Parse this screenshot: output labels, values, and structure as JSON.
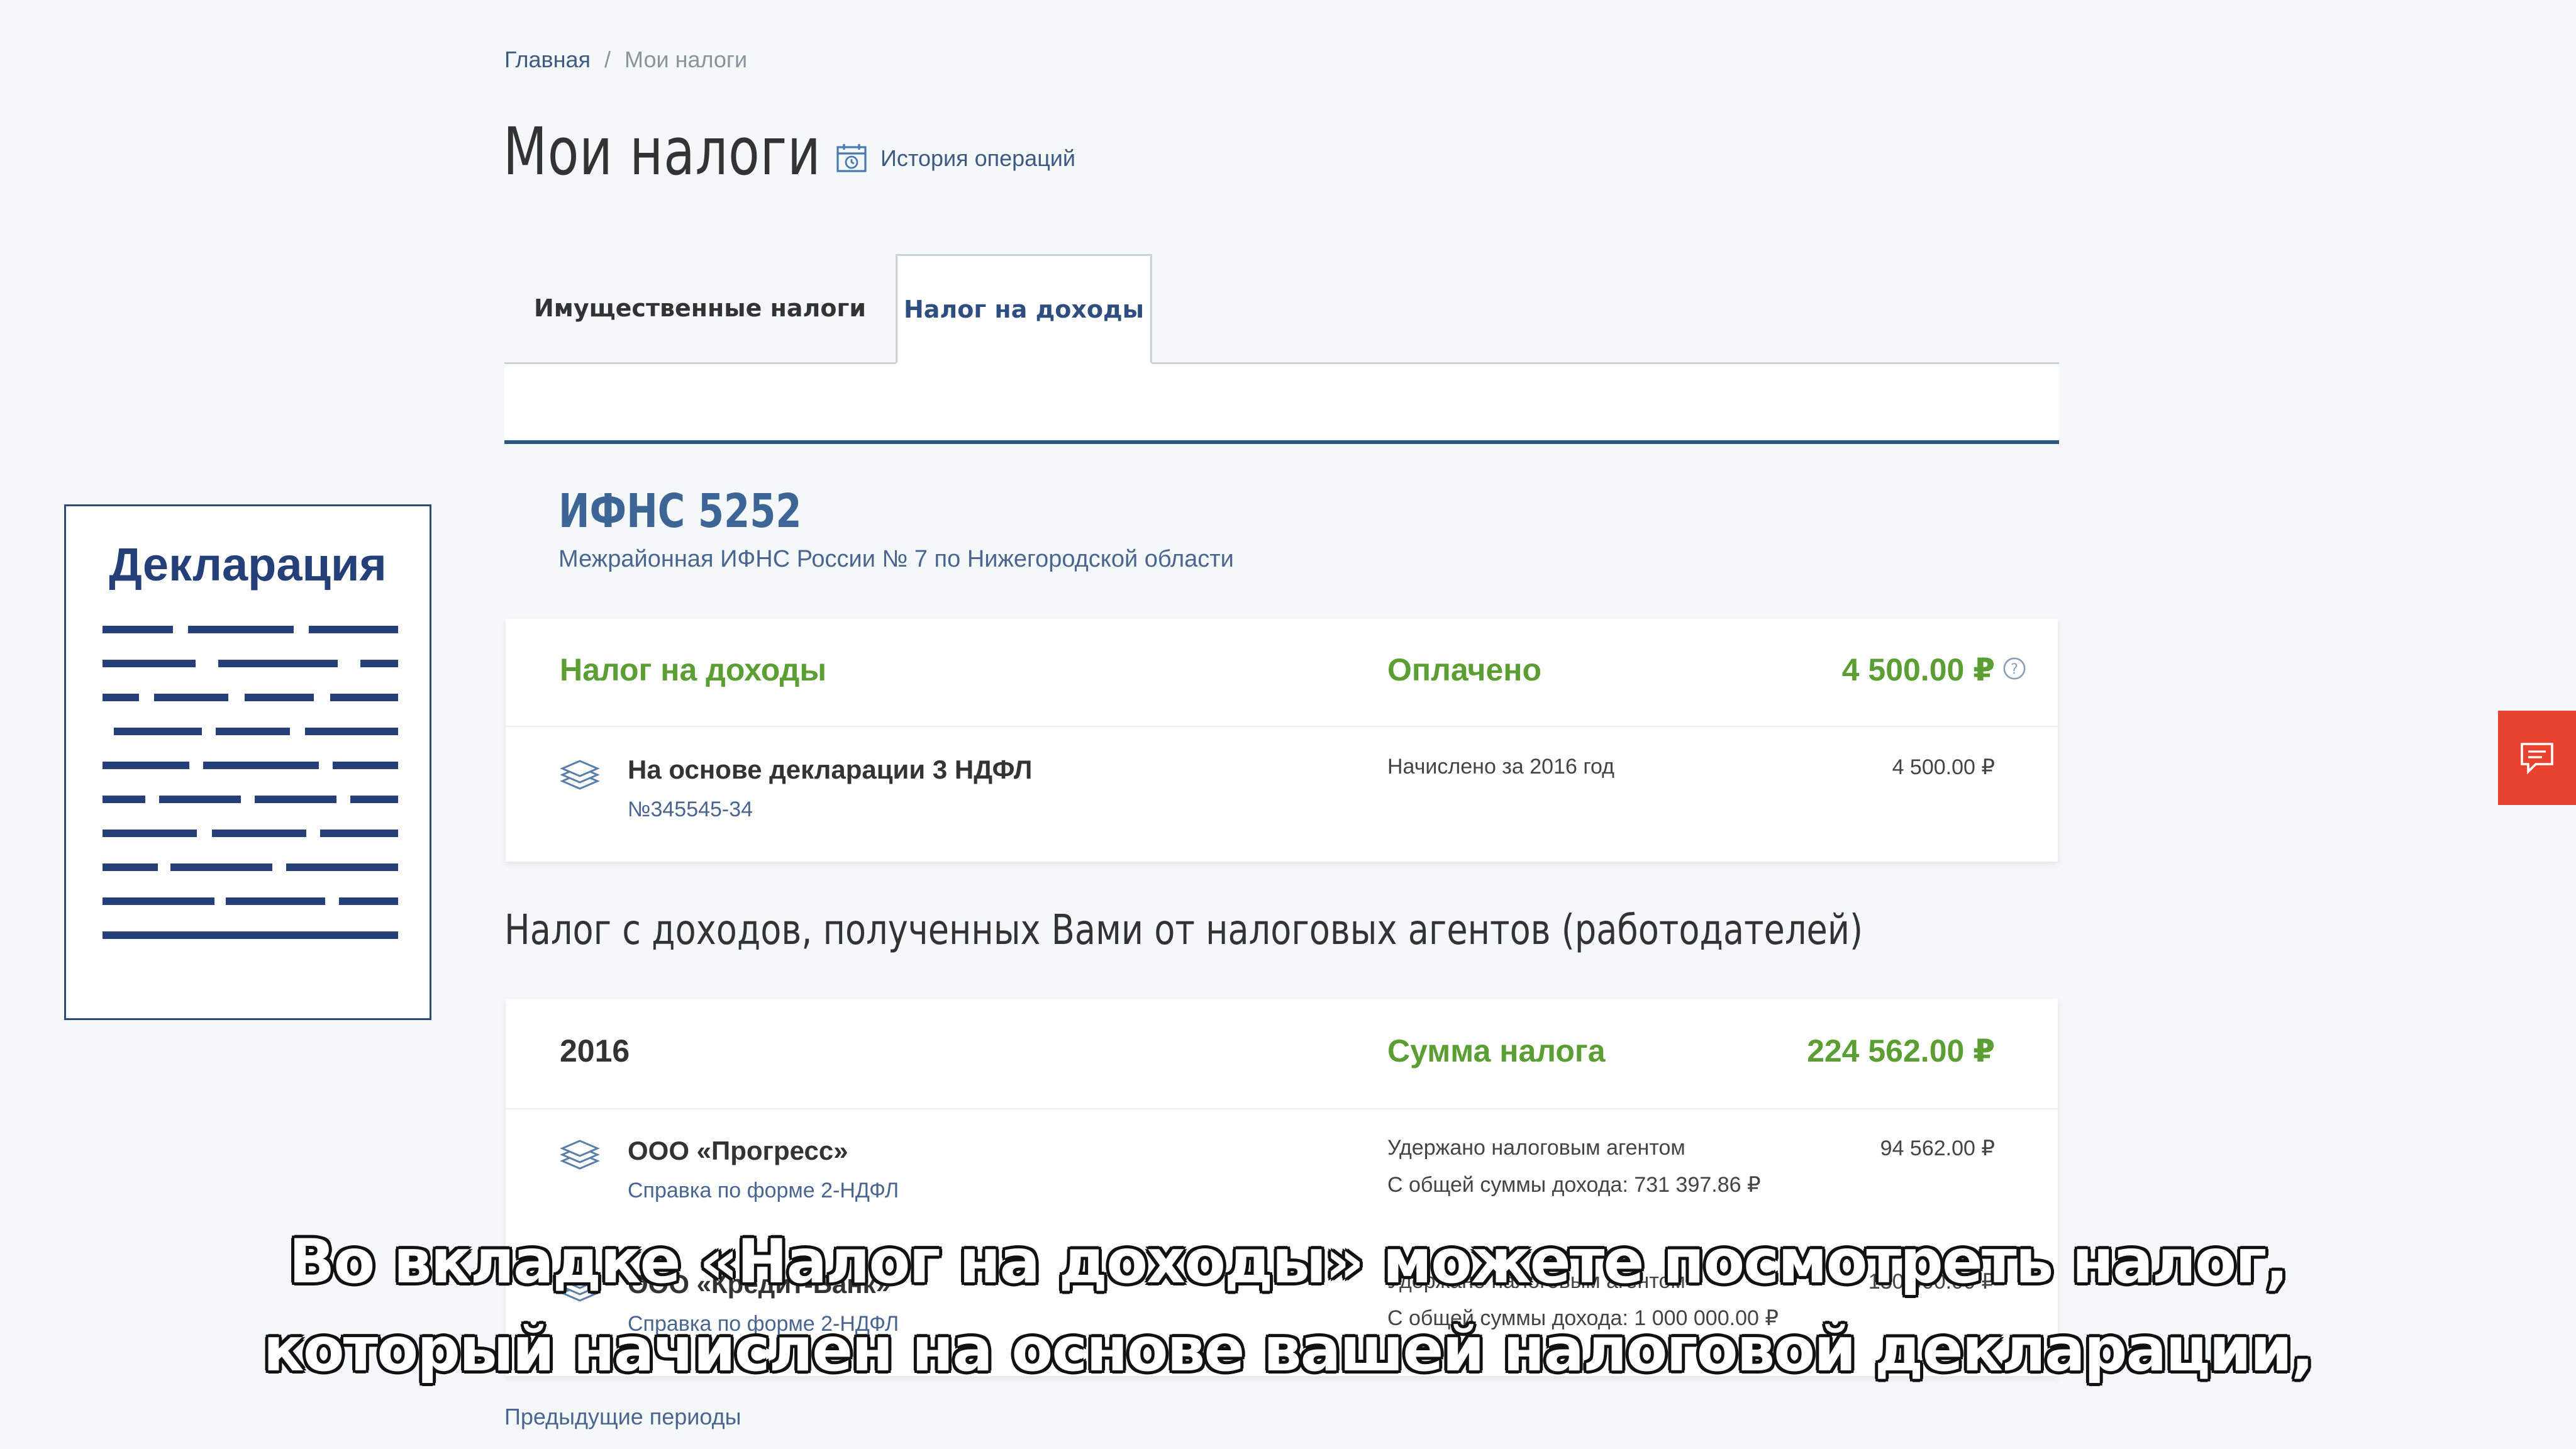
{
  "breadcrumb": {
    "home": "Главная",
    "separator": "/",
    "current": "Мои налоги"
  },
  "header": {
    "title": "Мои налоги",
    "history_label": "История операций"
  },
  "tabs": [
    {
      "label": "Имущественные налоги",
      "active": false
    },
    {
      "label": "Налог на доходы",
      "active": true
    }
  ],
  "ifns": {
    "code": "ИФНС 5252",
    "name": "Межрайонная ИФНС России № 7 по Нижегородской области"
  },
  "income_tax": {
    "title": "Налог на доходы",
    "status": "Оплачено",
    "amount": "4 500.00 ₽",
    "row": {
      "title": "На основе декларации 3 НДФЛ",
      "number": "№345545-34",
      "accrued_label": "Начислено за 2016 год",
      "amount": "4 500.00 ₽"
    }
  },
  "agents_section": {
    "title": "Налог с доходов, полученных Вами от налоговых агентов (работодателей)",
    "year": "2016",
    "sum_label": "Сумма налога",
    "sum_amount": "224 562.00 ₽",
    "rows": [
      {
        "title": "ООО «Прогресс»",
        "doc": "Справка по форме 2-НДФЛ",
        "withheld_label": "Удержано налоговым агентом",
        "withheld_amount": "94 562.00 ₽",
        "total_income": "С общей суммы дохода: 731 397.86 ₽"
      },
      {
        "title": "ООО «Кредит-Банк»",
        "doc": "Справка по форме 2-НДФЛ",
        "withheld_label": "Удержано налоговым агентом",
        "withheld_amount": "130 000.00 ₽",
        "total_income": "С общей суммы дохода: 1 000 000.00 ₽"
      }
    ]
  },
  "previous_periods": "Предыдущие периоды",
  "declaration_label": "Декларация",
  "subtitles": [
    "Во вкладке «Налог на доходы» можете посмотреть налог,",
    "который начислен на основе вашей налоговой декларации,"
  ],
  "colors": {
    "accent_blue": "#2b5583",
    "paid_green": "#5a9e34",
    "feedback_red": "#e8432e",
    "background": "#f4f8f9"
  },
  "icons": [
    "calendar-history-icon",
    "help-icon",
    "money-stack-icon",
    "chat-icon"
  ]
}
